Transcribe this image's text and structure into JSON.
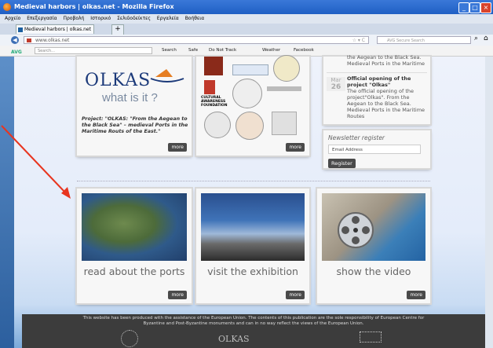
{
  "window": {
    "title": "Medieval harbors | olkas.net - Mozilla Firefox"
  },
  "menu": [
    "Αρχείο",
    "Επεξεργασία",
    "Προβολή",
    "Ιστορικό",
    "Σελιδοδείκτες",
    "Εργαλεία",
    "Βοήθεια"
  ],
  "tab": {
    "label": "Medieval harbors | olkas.net",
    "new_tab": "+"
  },
  "address": {
    "url": "www.olkas.net",
    "search_placeholder": "AVG Secure Search"
  },
  "avg_toolbar": {
    "brand": "AVG",
    "search_placeholder": "Search...",
    "items": [
      "Search",
      "Safe",
      "Do Not Track",
      "Weather",
      "Facebook"
    ]
  },
  "about_card": {
    "logo_text": "OLKAS",
    "tagline": "what is it ?",
    "description": "Project: \"OLKAS: \"From the Aegean to the Black Sea\" – medieval Ports in the Maritime Routs of the East.\"",
    "more": "more"
  },
  "partners_card": {
    "cultural_text": "CULTURAL AWARENESS FOUNDATION",
    "more": "more"
  },
  "news": {
    "top_snippet": "the Aegean to the Black Sea. Medieval Ports in the Maritime",
    "item_title": "Official opening of the project \"Olkas\"",
    "item_date_month": "Mar",
    "item_date_day": "26",
    "item_text": "The official opening of the project\"Olkas\". From the Aegean to the Black Sea. Medieval Ports in the Maritime Routes"
  },
  "newsletter": {
    "title": "Newsletter register",
    "placeholder": "Email Address",
    "button": "Register"
  },
  "feature_cards": [
    {
      "caption": "read about the ports",
      "more": "more"
    },
    {
      "caption": "visit the exhibition",
      "more": "more"
    },
    {
      "caption": "show the video",
      "more": "more"
    }
  ],
  "footer": {
    "text": "This website has been produced with the assistance of the European Union. The contents of this publication are the sole responsibility of European Centre for Byzantine and Post-Byzantine monuments and can in no way reflect the views of the European Union.",
    "logo": "OLKAS"
  },
  "colors": {
    "accent": "#1f5fc4",
    "arrow": "#e8351f",
    "footer": "#3c3c3c"
  }
}
